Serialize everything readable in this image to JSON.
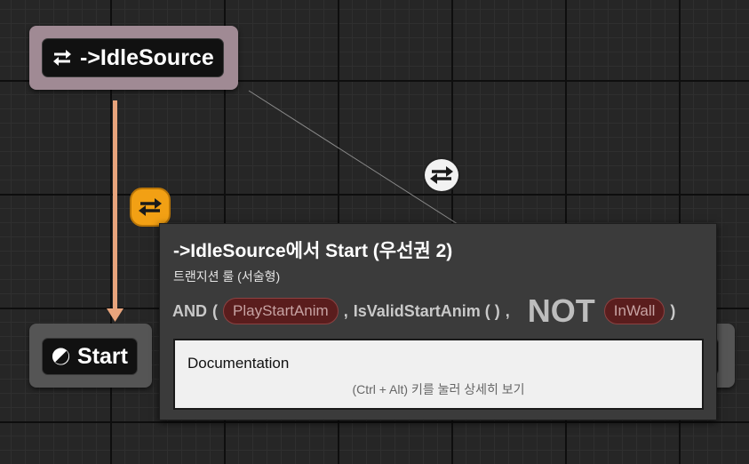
{
  "nodes": {
    "idle_source": {
      "label": "->IdleSource",
      "icon": "transition-arrows-icon"
    },
    "start": {
      "label": "Start",
      "icon": "entry-state-icon"
    }
  },
  "colors": {
    "transition_wire": "#e8a47c",
    "selected_wire": "#8a8a8a",
    "idle_node_frame": "#a08a94",
    "orange_transition": "#f2a014",
    "pill_bg": "#5a1d1d"
  },
  "tooltip": {
    "title": "->IdleSource에서 Start (우선권 2)",
    "subtitle": "트랜지션 룰 (서술형)",
    "condition": {
      "and": "AND",
      "open": "(",
      "play_start_anim": "PlayStartAnim",
      "comma1": ",",
      "is_valid": "IsValidStartAnim ( )",
      "comma2": ",",
      "not": "NOT",
      "in_wall": "InWall",
      "close": ")"
    },
    "documentation": {
      "title": "Documentation",
      "hint": "(Ctrl + Alt) 키를 눌러 상세히 보기"
    }
  }
}
